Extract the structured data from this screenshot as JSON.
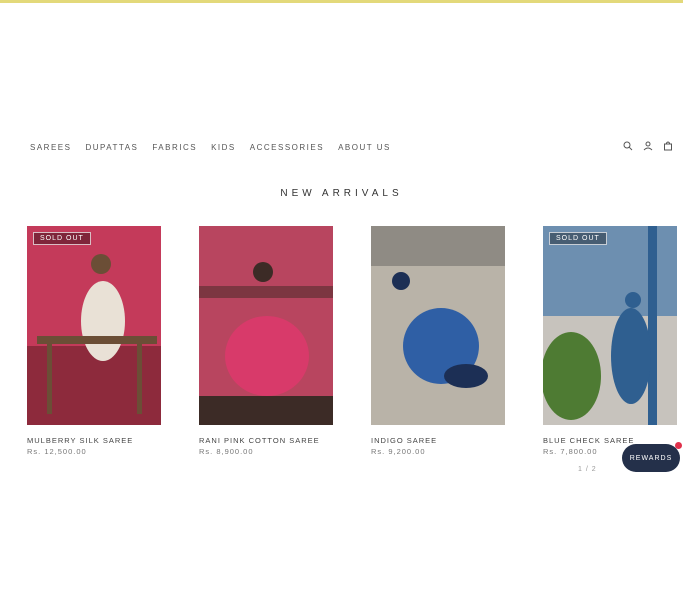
{
  "colors": {
    "topbar": "#e3d97a",
    "badge_text": "#ffffff",
    "reward_bg": "#24304a",
    "reward_dot": "#e0314b"
  },
  "nav": {
    "items": [
      {
        "label": "SAREES"
      },
      {
        "label": "DUPATTAS"
      },
      {
        "label": "FABRICS"
      },
      {
        "label": "KIDS"
      },
      {
        "label": "ACCESSORIES"
      },
      {
        "label": "ABOUT US"
      }
    ]
  },
  "tools": {
    "icons": [
      "search-icon",
      "account-icon",
      "bag-icon"
    ]
  },
  "section": {
    "title": "NEW ARRIVALS"
  },
  "products": [
    {
      "badge": "SOLD OUT",
      "name": "MULBERRY SILK SAREE",
      "price": "Rs. 12,500.00",
      "palette": [
        "#c43a5a",
        "#8d2a3c",
        "#e9e1d6",
        "#6b4e36"
      ]
    },
    {
      "badge": "",
      "name": "RANI PINK COTTON SAREE",
      "price": "Rs. 8,900.00",
      "palette": [
        "#b8455f",
        "#7c3641",
        "#d83a6a",
        "#3c2b26"
      ]
    },
    {
      "badge": "",
      "name": "INDIGO SAREE",
      "price": "Rs. 9,200.00",
      "palette": [
        "#b9b3a8",
        "#8f8b84",
        "#2f5fa5",
        "#1c2f55"
      ]
    },
    {
      "badge": "SOLD OUT",
      "name": "BLUE CHECK SAREE",
      "price": "Rs. 7,800.00",
      "palette": [
        "#6d8fb0",
        "#c7c3bd",
        "#2f5f90",
        "#4e7b33"
      ]
    }
  ],
  "pager": {
    "text": "1 / 2"
  },
  "reward": {
    "label": "REWARDS"
  }
}
